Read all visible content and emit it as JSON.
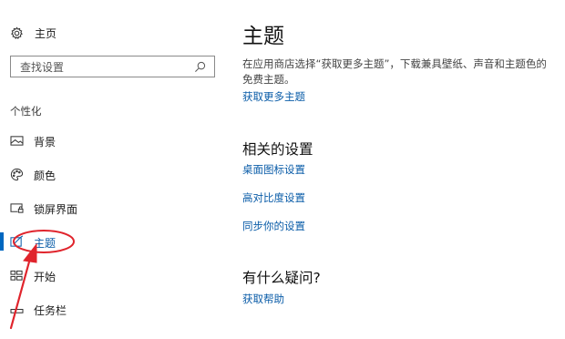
{
  "sidebar": {
    "home_label": "主页",
    "home_icon": "gear-icon",
    "search_placeholder": "查找设置",
    "search_icon": "search-icon",
    "section_label": "个性化",
    "items": [
      {
        "label": "背景",
        "icon": "picture-icon",
        "active": false
      },
      {
        "label": "颜色",
        "icon": "palette-icon",
        "active": false
      },
      {
        "label": "锁屏界面",
        "icon": "lock-screen-icon",
        "active": false
      },
      {
        "label": "主题",
        "icon": "theme-brush-icon",
        "active": true
      },
      {
        "label": "开始",
        "icon": "start-tiles-icon",
        "active": false
      },
      {
        "label": "任务栏",
        "icon": "taskbar-icon",
        "active": false
      }
    ],
    "accent_color": "#0067c0"
  },
  "main": {
    "title": "主题",
    "description": "在应用商店选择“获取更多主题”，下载兼具壁纸、声音和主题色的免费主题。",
    "get_more_link": "获取更多主题",
    "related_heading": "相关的设置",
    "related_links": [
      "桌面图标设置",
      "高对比度设置",
      "同步你的设置"
    ],
    "question_heading": "有什么疑问?",
    "help_link": "获取帮助",
    "link_color": "#0a5ca8"
  },
  "annotation": {
    "color": "#e0242c"
  }
}
